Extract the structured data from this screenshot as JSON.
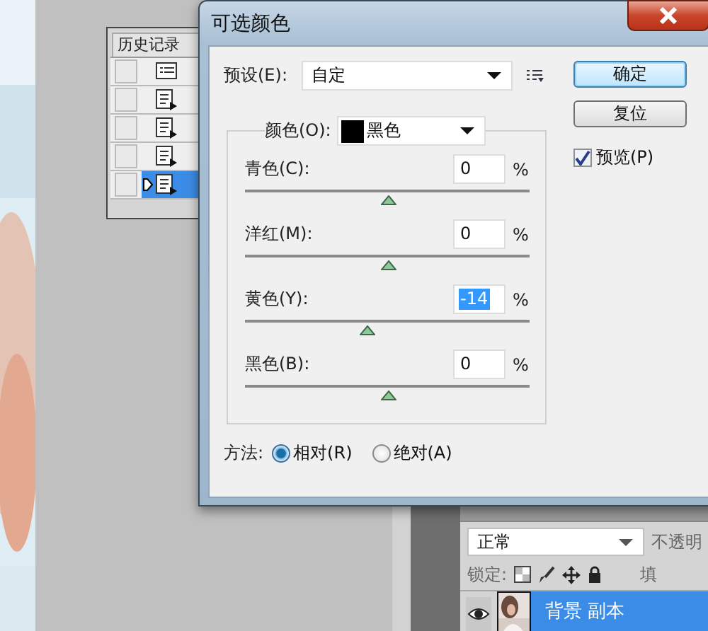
{
  "history_panel": {
    "title": "历史记录",
    "items": [
      {
        "kind": "snapshot",
        "selected": false
      },
      {
        "kind": "step",
        "selected": false
      },
      {
        "kind": "step",
        "selected": false
      },
      {
        "kind": "step",
        "selected": false
      },
      {
        "kind": "step",
        "selected": true
      }
    ]
  },
  "dialog": {
    "title": "可选颜色",
    "preset": {
      "label": "预设(E):",
      "value": "自定"
    },
    "colors": {
      "label": "颜色(O):",
      "value": "黑色"
    },
    "channels": [
      {
        "label": "青色(C):",
        "value": "0",
        "unit": "%",
        "level": 0.5,
        "focused": false
      },
      {
        "label": "洋红(M):",
        "value": "0",
        "unit": "%",
        "level": 0.5,
        "focused": false
      },
      {
        "label": "黄色(Y):",
        "value": "-14",
        "unit": "%",
        "level": 0.43,
        "focused": true
      },
      {
        "label": "黑色(B):",
        "value": "0",
        "unit": "%",
        "level": 0.5,
        "focused": false
      }
    ],
    "method": {
      "label": "方法:",
      "options": [
        {
          "label": "相对(R)",
          "selected": true
        },
        {
          "label": "绝对(A)",
          "selected": false
        }
      ]
    },
    "buttons": [
      {
        "label": "确定",
        "default": true
      },
      {
        "label": "复位",
        "default": false
      }
    ],
    "preview": {
      "label": "预览(P)",
      "checked": true
    }
  },
  "layers_panel": {
    "blend_mode": "正常",
    "opacity_label": "不透明",
    "lock_label": "锁定:",
    "fill_label": "填",
    "layers": [
      {
        "name": "背景 副本",
        "selected": true,
        "visible": true
      }
    ]
  }
}
